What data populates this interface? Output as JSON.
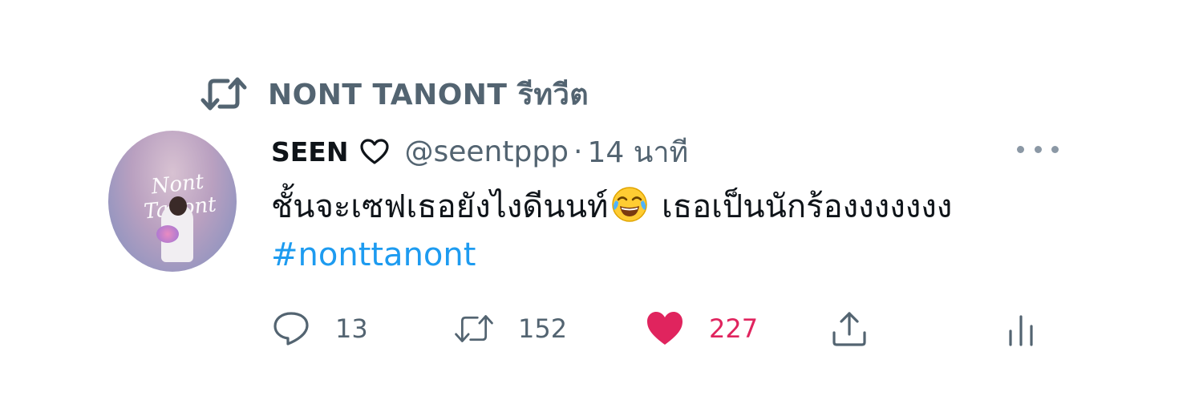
{
  "retweet_context": {
    "label": "NONT TANONT รีทวีต"
  },
  "tweet": {
    "display_name": "SEEN",
    "handle": "@seentppp",
    "separator": "·",
    "timestamp": "14 นาที",
    "text_before_emoji": "ชั้นจะเซฟเธอยังไงดีนนท์",
    "emoji": "face-with-tears-of-joy",
    "text_after_emoji": " เธอเป็นนักร้องงงงงงง ",
    "hashtag": "#nonttanont",
    "avatar_text": "Nont Tanont"
  },
  "actions": {
    "reply_count": "13",
    "retweet_count": "152",
    "like_count": "227",
    "liked": true
  },
  "colors": {
    "text": "#0f1419",
    "secondary": "#536471",
    "link": "#1d9bf0",
    "like": "#e0245e"
  }
}
